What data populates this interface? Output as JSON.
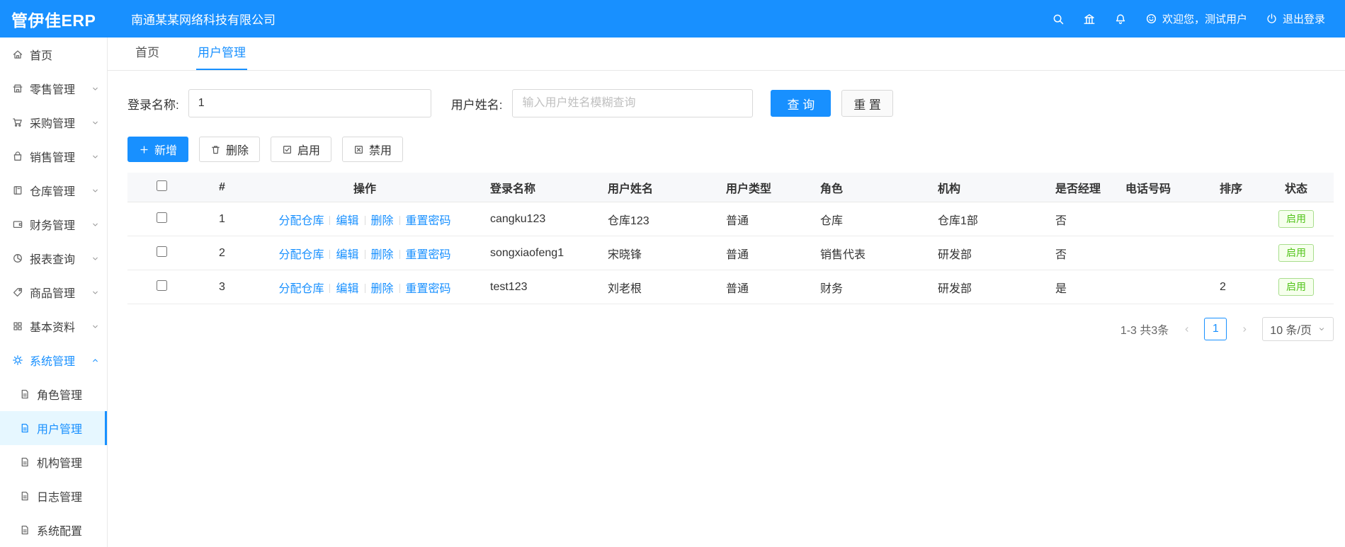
{
  "colors": {
    "accent": "#1890ff",
    "status_green": "#52c41a",
    "selected_menu_bg": "#e6f7ff"
  },
  "topbar": {
    "logo": "管伊佳ERP",
    "company": "南通某某网络科技有限公司",
    "greeting": "欢迎您，测试用户",
    "logout": "退出登录"
  },
  "tabs": [
    {
      "label": "首页",
      "active": false
    },
    {
      "label": "用户管理",
      "active": true
    }
  ],
  "sidebar": {
    "items": [
      {
        "label": "首页"
      },
      {
        "label": "零售管理"
      },
      {
        "label": "采购管理"
      },
      {
        "label": "销售管理"
      },
      {
        "label": "仓库管理"
      },
      {
        "label": "财务管理"
      },
      {
        "label": "报表查询"
      },
      {
        "label": "商品管理"
      },
      {
        "label": "基本资料"
      },
      {
        "label": "系统管理"
      }
    ],
    "submenu": [
      {
        "label": "角色管理"
      },
      {
        "label": "用户管理",
        "selected": true
      },
      {
        "label": "机构管理"
      },
      {
        "label": "日志管理"
      },
      {
        "label": "系统配置"
      }
    ]
  },
  "form": {
    "login_label": "登录名称:",
    "login_value": "1",
    "name_label": "用户姓名:",
    "name_placeholder": "输入用户姓名模糊查询",
    "search_button": "查 询",
    "reset_button": "重 置"
  },
  "toolbar": {
    "add": "新增",
    "delete": "删除",
    "enable": "启用",
    "disable": "禁用"
  },
  "table": {
    "headers": [
      "#",
      "操作",
      "登录名称",
      "用户姓名",
      "用户类型",
      "角色",
      "机构",
      "是否经理",
      "电话号码",
      "排序",
      "状态"
    ],
    "op_links": [
      "分配仓库",
      "编辑",
      "删除",
      "重置密码"
    ],
    "rows": [
      {
        "index": "1",
        "login": "cangku123",
        "name": "仓库123",
        "type": "普通",
        "role": "仓库",
        "org": "仓库1部",
        "manager": "否",
        "phone": "",
        "sort": "",
        "status": "启用"
      },
      {
        "index": "2",
        "login": "songxiaofeng1",
        "name": "宋晓锋",
        "type": "普通",
        "role": "销售代表",
        "org": "研发部",
        "manager": "否",
        "phone": "",
        "sort": "",
        "status": "启用"
      },
      {
        "index": "3",
        "login": "test123",
        "name": "刘老根",
        "type": "普通",
        "role": "财务",
        "org": "研发部",
        "manager": "是",
        "phone": "",
        "sort": "2",
        "status": "启用"
      }
    ]
  },
  "pagination": {
    "total": "1-3 共3条",
    "current_page": "1",
    "page_size": "10 条/页"
  }
}
